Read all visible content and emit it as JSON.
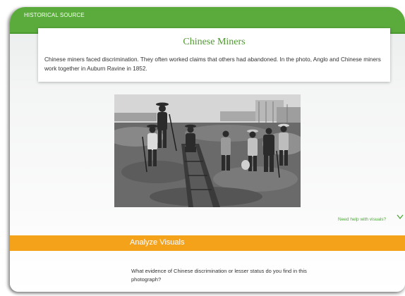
{
  "header": {
    "label": "HISTORICAL SOURCE"
  },
  "source": {
    "title": "Chinese Miners",
    "body": "Chinese miners faced discrimination. They often worked claims that others had abandoned. In the photo, Anglo and Chinese miners work together in Auburn Ravine in 1852."
  },
  "help": {
    "label": "Need help with visuals?"
  },
  "analyze": {
    "title": "Analyze Visuals",
    "question": "What evidence of Chinese discrimination or lesser status do you find in this photograph?"
  },
  "colors": {
    "header_green": "#5aaa3c",
    "title_green": "#4f9a2e",
    "analyze_orange": "#f5a21b"
  },
  "icons": {
    "help_toggle": "chevron-down-icon"
  }
}
